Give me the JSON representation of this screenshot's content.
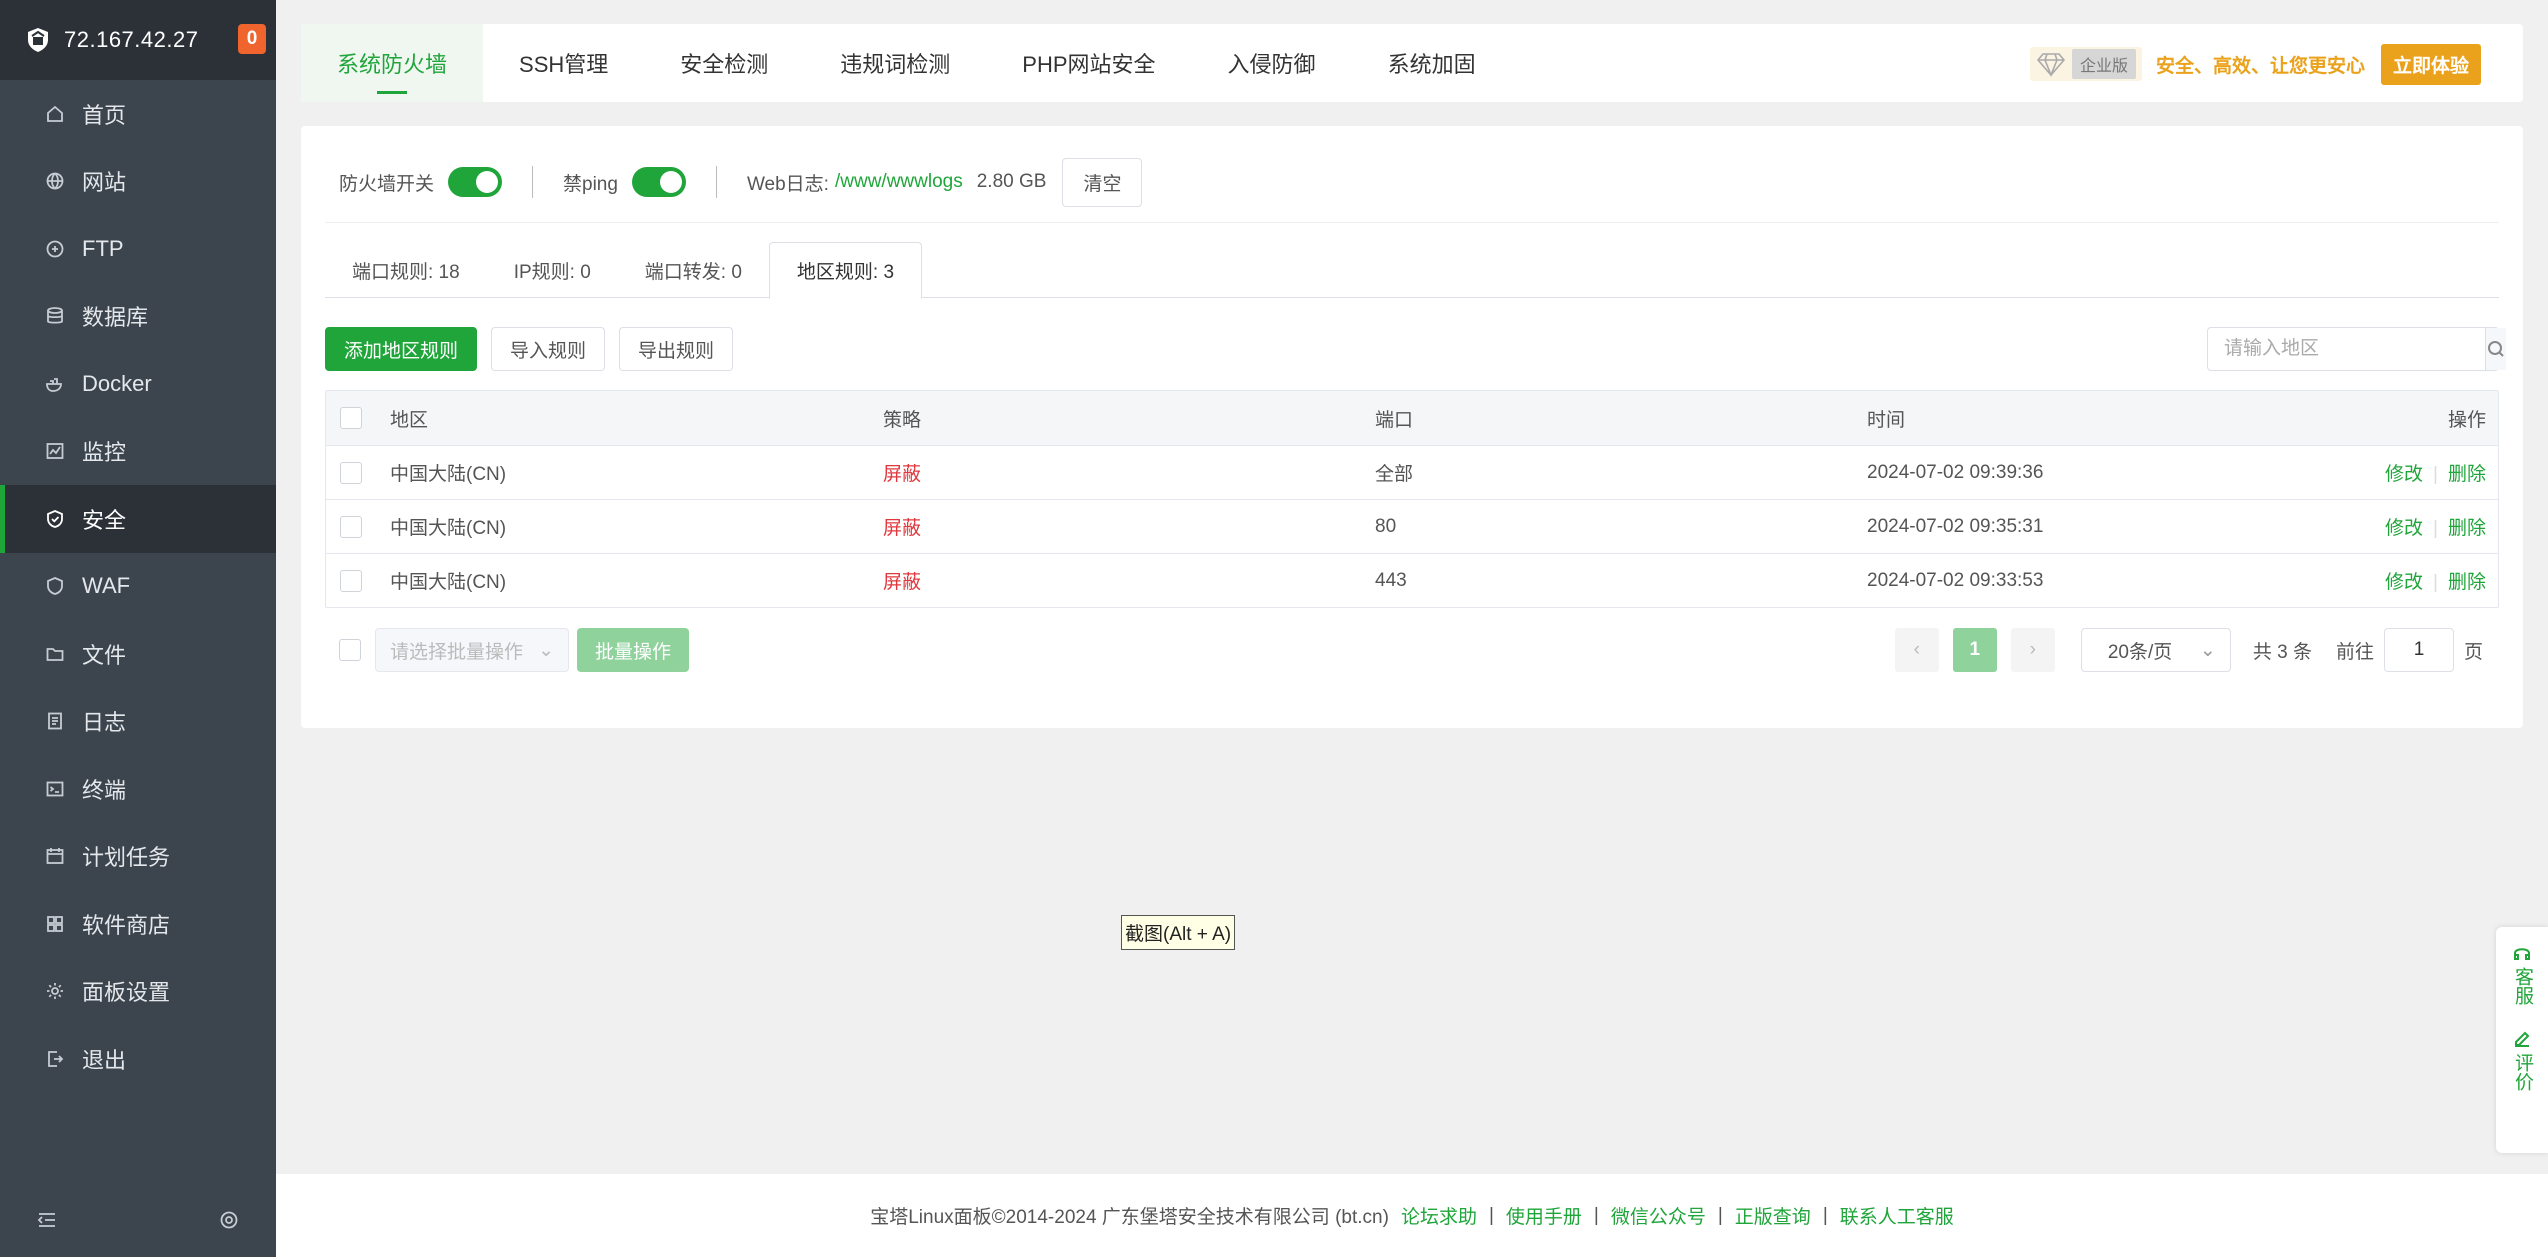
{
  "server": {
    "ip": "72.167.42.27",
    "badge": "0"
  },
  "sidebar": {
    "items": [
      {
        "label": "首页",
        "icon": "home-icon"
      },
      {
        "label": "网站",
        "icon": "globe-icon"
      },
      {
        "label": "FTP",
        "icon": "ftp-icon"
      },
      {
        "label": "数据库",
        "icon": "database-icon"
      },
      {
        "label": "Docker",
        "icon": "docker-icon"
      },
      {
        "label": "监控",
        "icon": "monitor-icon"
      },
      {
        "label": "安全",
        "icon": "shield-icon",
        "active": true
      },
      {
        "label": "WAF",
        "icon": "waf-icon"
      },
      {
        "label": "文件",
        "icon": "folder-icon"
      },
      {
        "label": "日志",
        "icon": "log-icon"
      },
      {
        "label": "终端",
        "icon": "terminal-icon"
      },
      {
        "label": "计划任务",
        "icon": "calendar-icon"
      },
      {
        "label": "软件商店",
        "icon": "apps-icon"
      },
      {
        "label": "面板设置",
        "icon": "gear-icon"
      },
      {
        "label": "退出",
        "icon": "logout-icon"
      }
    ]
  },
  "tabs": [
    "系统防火墙",
    "SSH管理",
    "安全检测",
    "违规词检测",
    "PHP网站安全",
    "入侵防御",
    "系统加固"
  ],
  "promo": {
    "edition": "企业版",
    "slogan": "安全、高效、让您更安心",
    "button": "立即体验"
  },
  "status": {
    "firewall_label": "防火墙开关",
    "ping_label": "禁ping",
    "weblog_label": "Web日志:",
    "weblog_path": "/www/wwwlogs",
    "weblog_size": "2.80 GB",
    "clear_button": "清空"
  },
  "subtabs": [
    "端口规则: 18",
    "IP规则: 0",
    "端口转发: 0",
    "地区规则: 3"
  ],
  "toolbar": {
    "add": "添加地区规则",
    "import": "导入规则",
    "export": "导出规则",
    "search_placeholder": "请输入地区"
  },
  "table": {
    "headers": {
      "region": "地区",
      "policy": "策略",
      "port": "端口",
      "time": "时间",
      "ops": "操作"
    },
    "rows": [
      {
        "region": "中国大陆(CN)",
        "policy": "屏蔽",
        "port": "全部",
        "time": "2024-07-02 09:39:36",
        "edit": "修改",
        "delete": "删除"
      },
      {
        "region": "中国大陆(CN)",
        "policy": "屏蔽",
        "port": "80",
        "time": "2024-07-02 09:35:31",
        "edit": "修改",
        "delete": "删除"
      },
      {
        "region": "中国大陆(CN)",
        "policy": "屏蔽",
        "port": "443",
        "time": "2024-07-02 09:33:53",
        "edit": "修改",
        "delete": "删除"
      }
    ]
  },
  "batch": {
    "placeholder": "请选择批量操作",
    "button": "批量操作"
  },
  "pager": {
    "current": "1",
    "size": "20条/页",
    "total": "共 3 条",
    "goto_prefix": "前往",
    "goto_value": "1",
    "goto_suffix": "页"
  },
  "tooltip": "截图(Alt + A)",
  "side_float": {
    "service": "客服",
    "review": "评价"
  },
  "footer": {
    "copyright": "宝塔Linux面板©2014-2024 广东堡塔安全技术有限公司 (bt.cn)",
    "links": [
      "论坛求助",
      "使用手册",
      "微信公众号",
      "正版查询",
      "联系人工客服"
    ]
  }
}
